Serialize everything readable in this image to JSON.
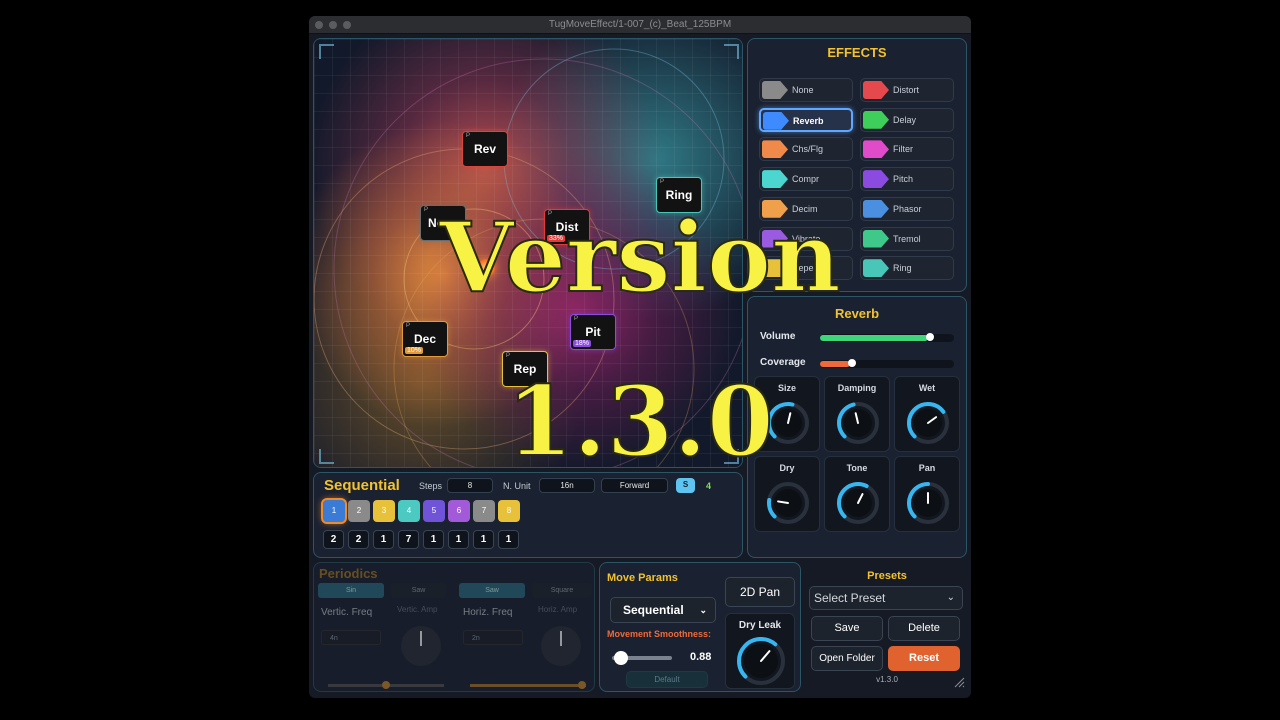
{
  "window": {
    "title": "TugMoveEffect/1-007_(c)_Beat_125BPM"
  },
  "pad": {
    "nodes": [
      {
        "name": "Rev",
        "color": "#d9463b"
      },
      {
        "name": "Ring",
        "color": "#48c7b8"
      },
      {
        "name": "None",
        "color": "#6b6b6b"
      },
      {
        "name": "Dist",
        "color": "#e03b3b",
        "percent": "33%"
      },
      {
        "name": "Dec",
        "color": "#e39a3a",
        "percent": "10%"
      },
      {
        "name": "Pit",
        "color": "#8b4be0",
        "percent": "18%"
      },
      {
        "name": "Rep",
        "color": "#e8c13b"
      }
    ],
    "node_marker": "P"
  },
  "sequencer": {
    "title": "Sequential",
    "steps_label": "Steps",
    "steps_value": "8",
    "note_unit_label": "N. Unit",
    "note_unit_value": "16n",
    "direction_value": "Forward",
    "s_button": "S",
    "s_value": "4",
    "steps": [
      {
        "label": "1",
        "color": "#3a7bd5"
      },
      {
        "label": "2",
        "color": "#8a8a8a"
      },
      {
        "label": "3",
        "color": "#e8c13b"
      },
      {
        "label": "4",
        "color": "#4cc9c0"
      },
      {
        "label": "5",
        "color": "#6f54d8"
      },
      {
        "label": "6",
        "color": "#a35ad8"
      },
      {
        "label": "7",
        "color": "#8a8a8a"
      },
      {
        "label": "8",
        "color": "#e8c13b"
      }
    ],
    "active_step_index": 0,
    "values": [
      "2",
      "2",
      "1",
      "7",
      "1",
      "1",
      "1",
      "1"
    ]
  },
  "effects": {
    "title": "EFFECTS",
    "selected": "Reverb",
    "items": [
      {
        "label": "None",
        "color": "#8a8a8a"
      },
      {
        "label": "Distort",
        "color": "#e5484d"
      },
      {
        "label": "Reverb",
        "color": "#3d8bff"
      },
      {
        "label": "Delay",
        "color": "#3ecf5a"
      },
      {
        "label": "Chs/Flg",
        "color": "#f08a4b"
      },
      {
        "label": "Filter",
        "color": "#e04bc9"
      },
      {
        "label": "Compr",
        "color": "#4cd6d0"
      },
      {
        "label": "Pitch",
        "color": "#8b4be0"
      },
      {
        "label": "Decim",
        "color": "#f0a04b"
      },
      {
        "label": "Phasor",
        "color": "#4b8fe0"
      },
      {
        "label": "Vibrato",
        "color": "#9b5be0"
      },
      {
        "label": "Tremol",
        "color": "#3ec98a"
      },
      {
        "label": "Repeat",
        "color": "#e8c13b"
      },
      {
        "label": "Ring",
        "color": "#48c7b8"
      }
    ]
  },
  "reverb": {
    "title": "Reverb",
    "volume_label": "Volume",
    "volume": 0.9,
    "coverage_label": "Coverage",
    "coverage": 0.25,
    "knobs": [
      {
        "label": "Size",
        "value": 0.55
      },
      {
        "label": "Damping",
        "value": 0.45
      },
      {
        "label": "Wet",
        "value": 0.7
      },
      {
        "label": "Dry",
        "value": 0.2
      },
      {
        "label": "Tone",
        "value": 0.6
      },
      {
        "label": "Pan",
        "value": 0.5
      }
    ]
  },
  "periodics": {
    "title": "Periodics",
    "buttons": [
      "Sin",
      "Saw",
      "Saw",
      "Square"
    ],
    "vert_label": "Vertic. Freq",
    "vert_amp": "Vertic. Amp",
    "vert_freq": "4n",
    "horiz_label": "Horiz. Freq",
    "horiz_amp": "Horiz. Amp",
    "horiz_freq": "2n"
  },
  "move": {
    "title": "Move Params",
    "mode": "Sequential",
    "pan_button": "2D Pan",
    "smooth_label": "Movement Smoothness:",
    "smoothness": "0.88",
    "dry_leak_label": "Dry Leak",
    "dry_leak": 0.65,
    "bottom_button": "Default"
  },
  "presets": {
    "title": "Presets",
    "select_placeholder": "Select Preset",
    "save": "Save",
    "delete": "Delete",
    "open_folder": "Open Folder",
    "reset": "Reset",
    "version": "v1.3.0"
  },
  "overlay": {
    "line1": "Version",
    "line2": "1.3.0"
  },
  "colors": {
    "accent": "#f2c230",
    "reset": "#e0622f",
    "knob": "#38b6f0",
    "overlay": "#f7f244"
  }
}
